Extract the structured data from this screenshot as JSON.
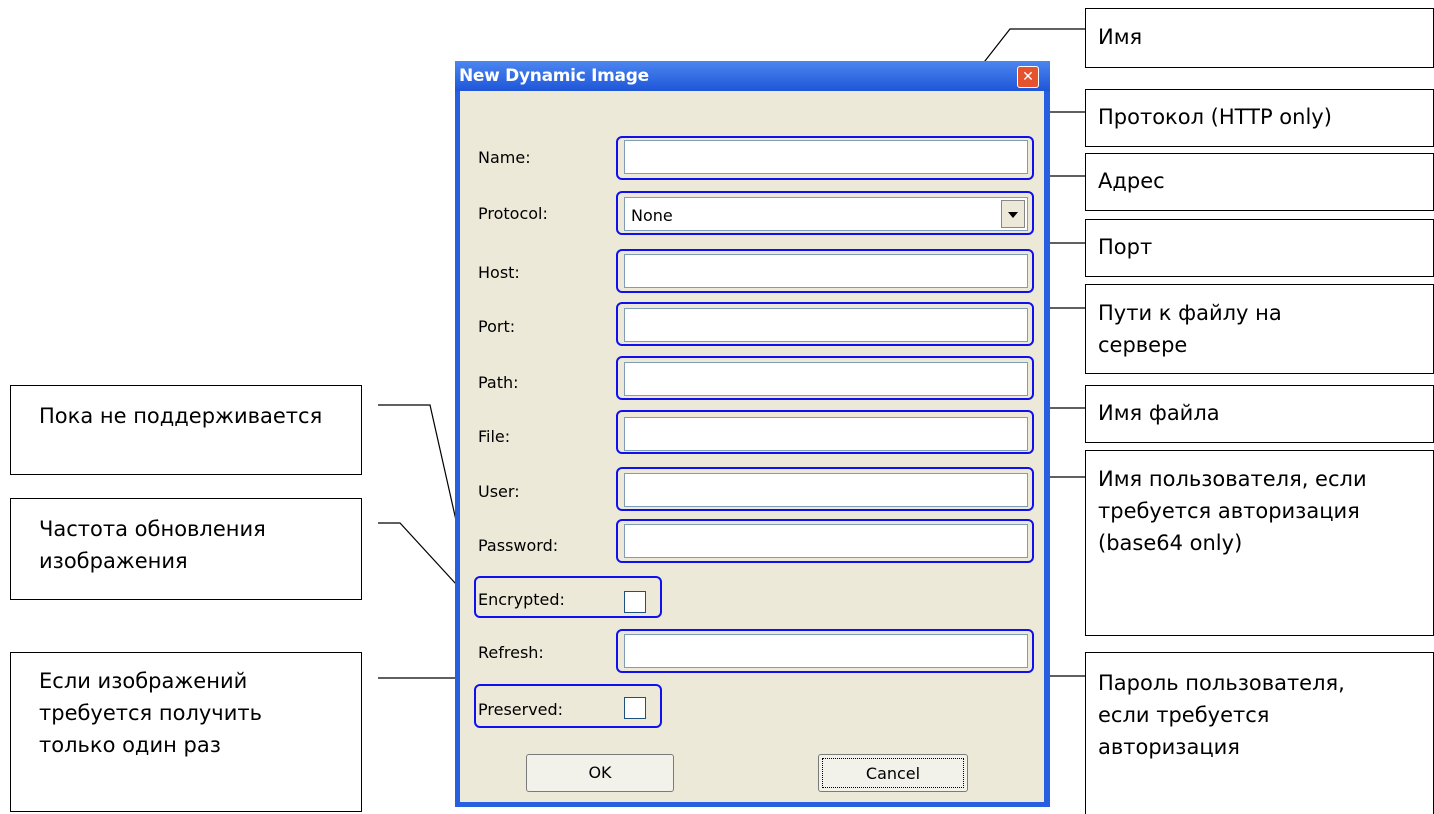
{
  "dialog": {
    "title": "New Dynamic Image",
    "close_icon": "close-icon",
    "labels": {
      "name": "Name:",
      "protocol": "Protocol:",
      "host": "Host:",
      "port": "Port:",
      "path": "Path:",
      "file": "File:",
      "user": "User:",
      "password": "Password:",
      "encrypted": "Encrypted:",
      "refresh": "Refresh:",
      "preserved": "Preserved:"
    },
    "fields": {
      "name": "",
      "host": "",
      "port": "",
      "path": "",
      "file": "",
      "user": "",
      "password": "",
      "refresh": ""
    },
    "protocol_selected": "None",
    "ok_label": "OK",
    "cancel_label": "Cancel"
  },
  "annotations": {
    "name": "Имя",
    "protocol": "Протокол (HTTP only)",
    "host": "Адрес",
    "port": "Порт",
    "path": "Пути к файлу на сервере",
    "file": "Имя файла",
    "user": "Имя пользователя, если требуется авторизация (base64 only)",
    "password": "Пароль пользователя, если требуется авторизация",
    "encrypted": "Пока не поддерживается",
    "refresh": "Частота обновления изображения",
    "preserved": "Если изображений требуется получить только один раз"
  },
  "colors": {
    "title_bar": "#1e56d8",
    "highlight": "#1010ee",
    "dialog_bg": "#ece9d8"
  }
}
